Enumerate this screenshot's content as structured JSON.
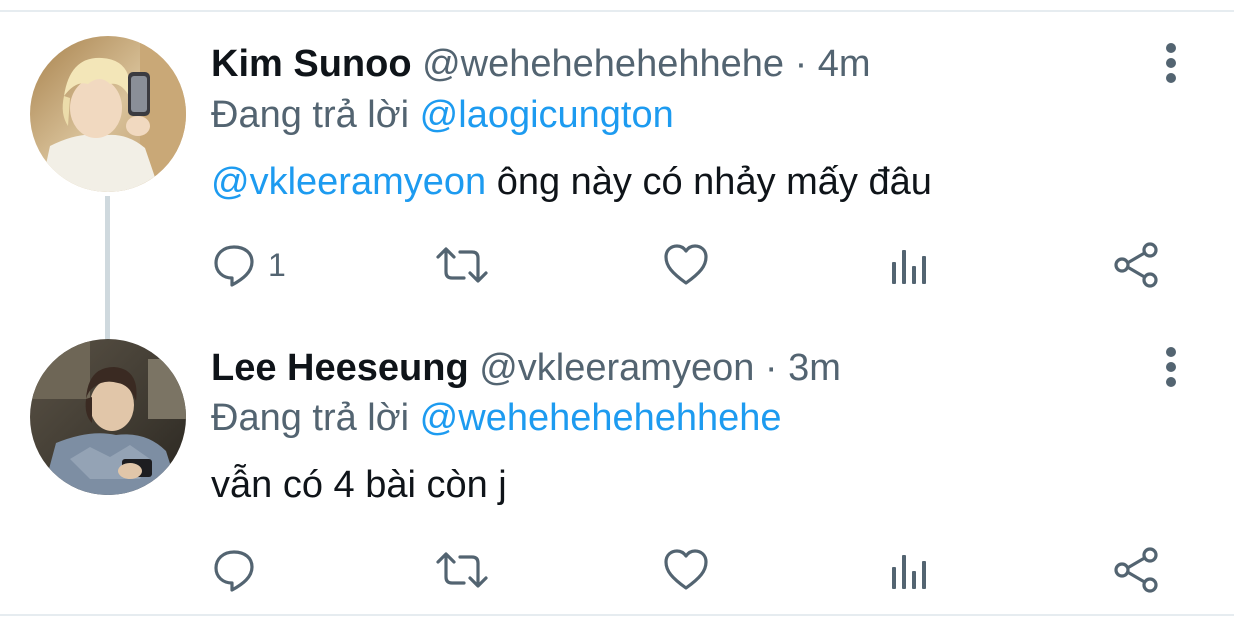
{
  "tweets": [
    {
      "display_name": "Kim Sunoo",
      "handle": "@wehehehehehhehe",
      "separator": "·",
      "time": "4m",
      "reply_prefix": "Đang trả lời",
      "reply_to": "@laogicungton",
      "body_mention": "@vkleeramyeon",
      "body_text": " ông này có nhảy mấy đâu",
      "reply_count": "1"
    },
    {
      "display_name": "Lee Heeseung",
      "handle": "@vkleeramyeon",
      "separator": "·",
      "time": "3m",
      "reply_prefix": "Đang trả lời",
      "reply_to": "@wehehehehehhehe",
      "body_mention": "",
      "body_text": "vẫn có 4 bài còn j",
      "reply_count": ""
    }
  ],
  "colors": {
    "accent": "#1d9bf0",
    "secondary_text": "#536471",
    "primary_text": "#0f1419",
    "thread_line": "#cfd9de",
    "divider": "#e6ecf0"
  },
  "icons": {
    "reply": "speech-bubble-icon",
    "retweet": "retweet-arrows-icon",
    "like": "heart-icon",
    "analytics": "bar-chart-icon",
    "share": "share-nodes-icon",
    "more": "vertical-ellipsis-icon"
  }
}
